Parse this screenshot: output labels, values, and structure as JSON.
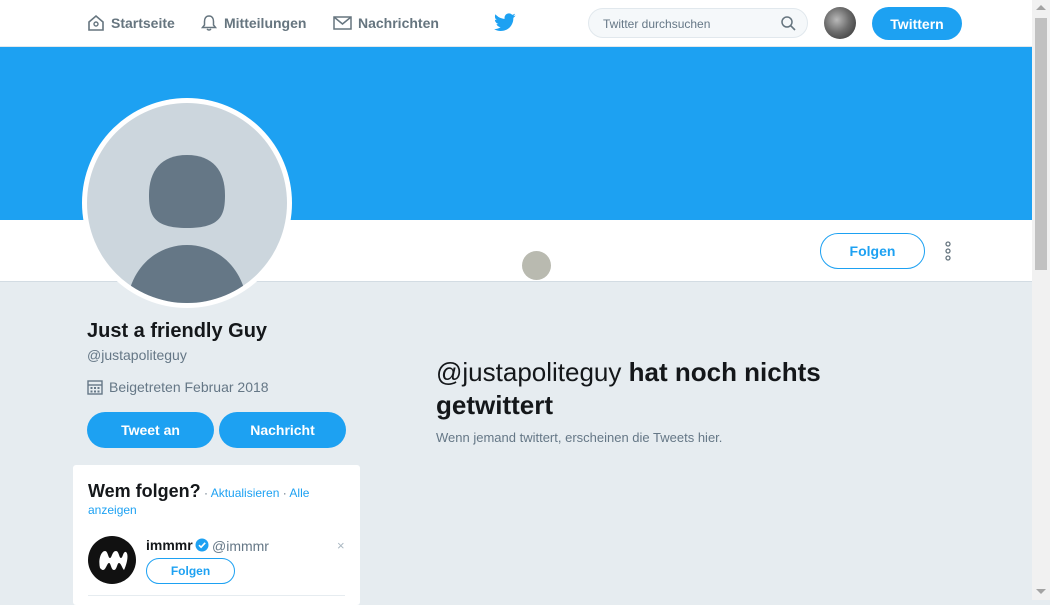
{
  "nav": {
    "home": "Startseite",
    "notifications": "Mitteilungen",
    "messages": "Nachrichten",
    "search_placeholder": "Twitter durchsuchen",
    "tweet_button": "Twittern"
  },
  "profile": {
    "name": "Just a friendly Guy",
    "handle": "@justapoliteguy",
    "joined": "Beigetreten Februar 2018",
    "follow_button": "Folgen",
    "tweet_to_button": "Tweet an",
    "message_button": "Nachricht"
  },
  "empty_state": {
    "handle": "@justapoliteguy",
    "title_rest": "hat noch nichts getwittert",
    "subtitle": "Wenn jemand twittert, erscheinen die Tweets hier."
  },
  "who_to_follow": {
    "title": "Wem folgen?",
    "separator": "·",
    "refresh": "Aktualisieren",
    "view_all": "Alle anzeigen",
    "suggestion": {
      "name": "immmr",
      "handle": "@immmr",
      "follow": "Folgen",
      "close": "×"
    }
  },
  "colors": {
    "brand": "#1da1f2",
    "background": "#e6ecf0"
  },
  "icons": [
    "home-icon",
    "bell-icon",
    "mail-icon",
    "twitter-bird-icon",
    "search-icon",
    "calendar-icon",
    "verified-icon",
    "more-icon"
  ]
}
